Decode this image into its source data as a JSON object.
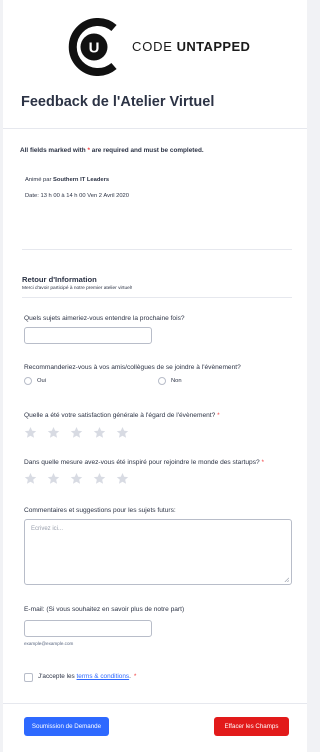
{
  "logo": {
    "thin": "CODE",
    "bold": "UNTAPPED",
    "letter": "U"
  },
  "title": "Feedback de l'Atelier Virtuel",
  "required_note": {
    "before": "All fields marked with ",
    "star": "*",
    "after": " are required and must be completed."
  },
  "host": {
    "prefix": "Animé par ",
    "name": "Southern IT Leaders"
  },
  "date": "Date: 13 h 00 à 14 h 00 Ven 2 Avril 2020",
  "section": {
    "title": "Retour d'Information",
    "subtitle": "Merci d'avoir participé à notre premier atelier virtuel!"
  },
  "q_topics": {
    "label": "Quels sujets aimeriez-vous entendre la prochaine fois?",
    "value": ""
  },
  "q_recommend": {
    "label": "Recommanderiez-vous à vos amis/collègues de se joindre à l'évènement?",
    "options": [
      "Oui",
      "Non"
    ]
  },
  "q_satisfaction": {
    "label": "Quelle a été votre satisfaction générale à l'égard de l'évènement?",
    "required": "*",
    "rating": 0,
    "max": 5
  },
  "q_inspired": {
    "label": "Dans quelle mesure avez-vous été inspiré pour rejoindre le monde des startups?",
    "required": "*",
    "rating": 0,
    "max": 5
  },
  "q_comments": {
    "label": "Commentaires et suggestions pour les sujets futurs:",
    "placeholder": "Ecrivez ici..."
  },
  "q_email": {
    "label": "E-mail: (Si vous souhaitez en savoir plus de notre part)",
    "value": "",
    "sublabel": "example@example.com"
  },
  "terms": {
    "before": "J'accepte les ",
    "link": "terms & conditions",
    "after": ".",
    "required": "*"
  },
  "buttons": {
    "submit": "Soumission de Demande",
    "clear": "Effacer les Champs"
  },
  "colors": {
    "primary": "#2e69ff",
    "danger": "#e21a1a",
    "required": "#f23a3c",
    "star": "#d8dbe3"
  }
}
